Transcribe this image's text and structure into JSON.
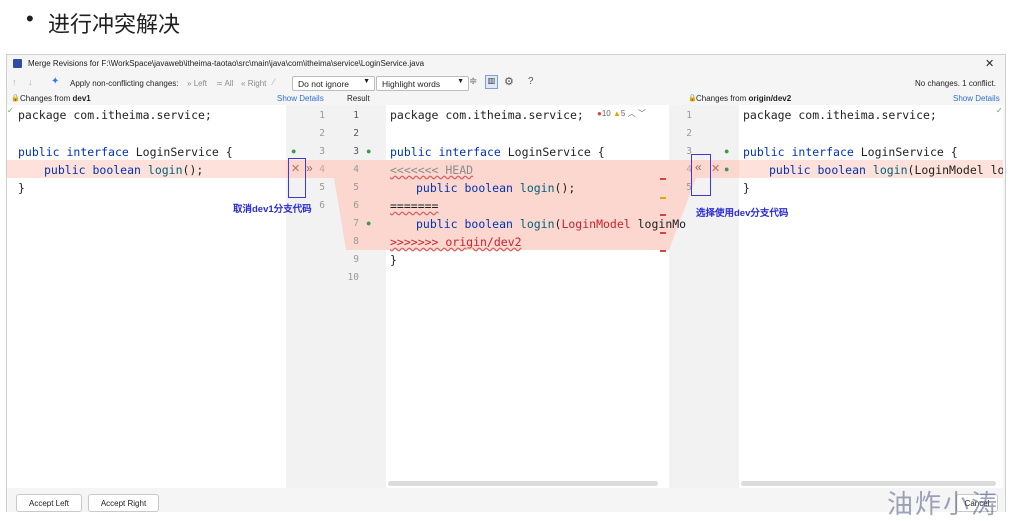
{
  "slide": {
    "bullet": "•",
    "title": "进行冲突解决"
  },
  "window": {
    "title": "Merge Revisions for F:\\WorkSpace\\javaweb\\itheima-taotao\\src\\main\\java\\com\\itheima\\service\\LoginService.java",
    "close": "✕"
  },
  "toolbar": {
    "apply_label": "Apply non-conflicting changes:",
    "left": "Left",
    "all": "All",
    "right": "Right",
    "ignore_dropdown": "Do not ignore",
    "highlight_dropdown": "Highlight words",
    "help": "?",
    "status": "No changes. 1 conflict."
  },
  "panes": {
    "left_header_prefix": "Changes from",
    "left_header_branch": "dev1",
    "show_details": "Show Details",
    "result_header": "Result",
    "right_header_prefix": "Changes from",
    "right_header_branch": "origin/dev2"
  },
  "inspection": {
    "errors": "10",
    "warnings": "5"
  },
  "code": {
    "package": "package com.itheima.service;",
    "kw_public": "public",
    "kw_interface": "interface",
    "kw_boolean": "boolean",
    "cls": "LoginService {",
    "fn_login": "login",
    "left_args": "();",
    "close_brace": "}",
    "head_marker": "<<<<<<< HEAD",
    "sep_marker": "=======",
    "origin_marker": ">>>>>>> origin/dev2",
    "result_args": "(LoginModel loginMo",
    "right_args": "(LoginModel login",
    "open_paren": "(",
    "loginmodel": "LoginModel",
    "loginmo": " loginMo"
  },
  "gutter": {
    "left_numbers": [
      "1",
      "2",
      "3",
      "4",
      "5",
      "6"
    ],
    "result_numbers": [
      "1",
      "2",
      "3",
      "4",
      "5",
      "6",
      "7",
      "8",
      "9",
      "10"
    ],
    "right_numbers": [
      "1",
      "2",
      "3",
      "4",
      "5"
    ]
  },
  "annotations": {
    "left": "取消dev1分支代码",
    "right": "选择使用dev分支代码"
  },
  "buttons": {
    "accept_left": "Accept Left",
    "accept_right": "Accept Right",
    "cancel": "Cancel"
  },
  "watermark": "油炸小涛",
  "colors": {
    "conflict_bg": "#fbd7cf",
    "conflict_band": "#fde1da",
    "keyword": "#0033b3",
    "function": "#00627a",
    "marker": "#c7222d",
    "annotation": "#2b2bd6"
  }
}
